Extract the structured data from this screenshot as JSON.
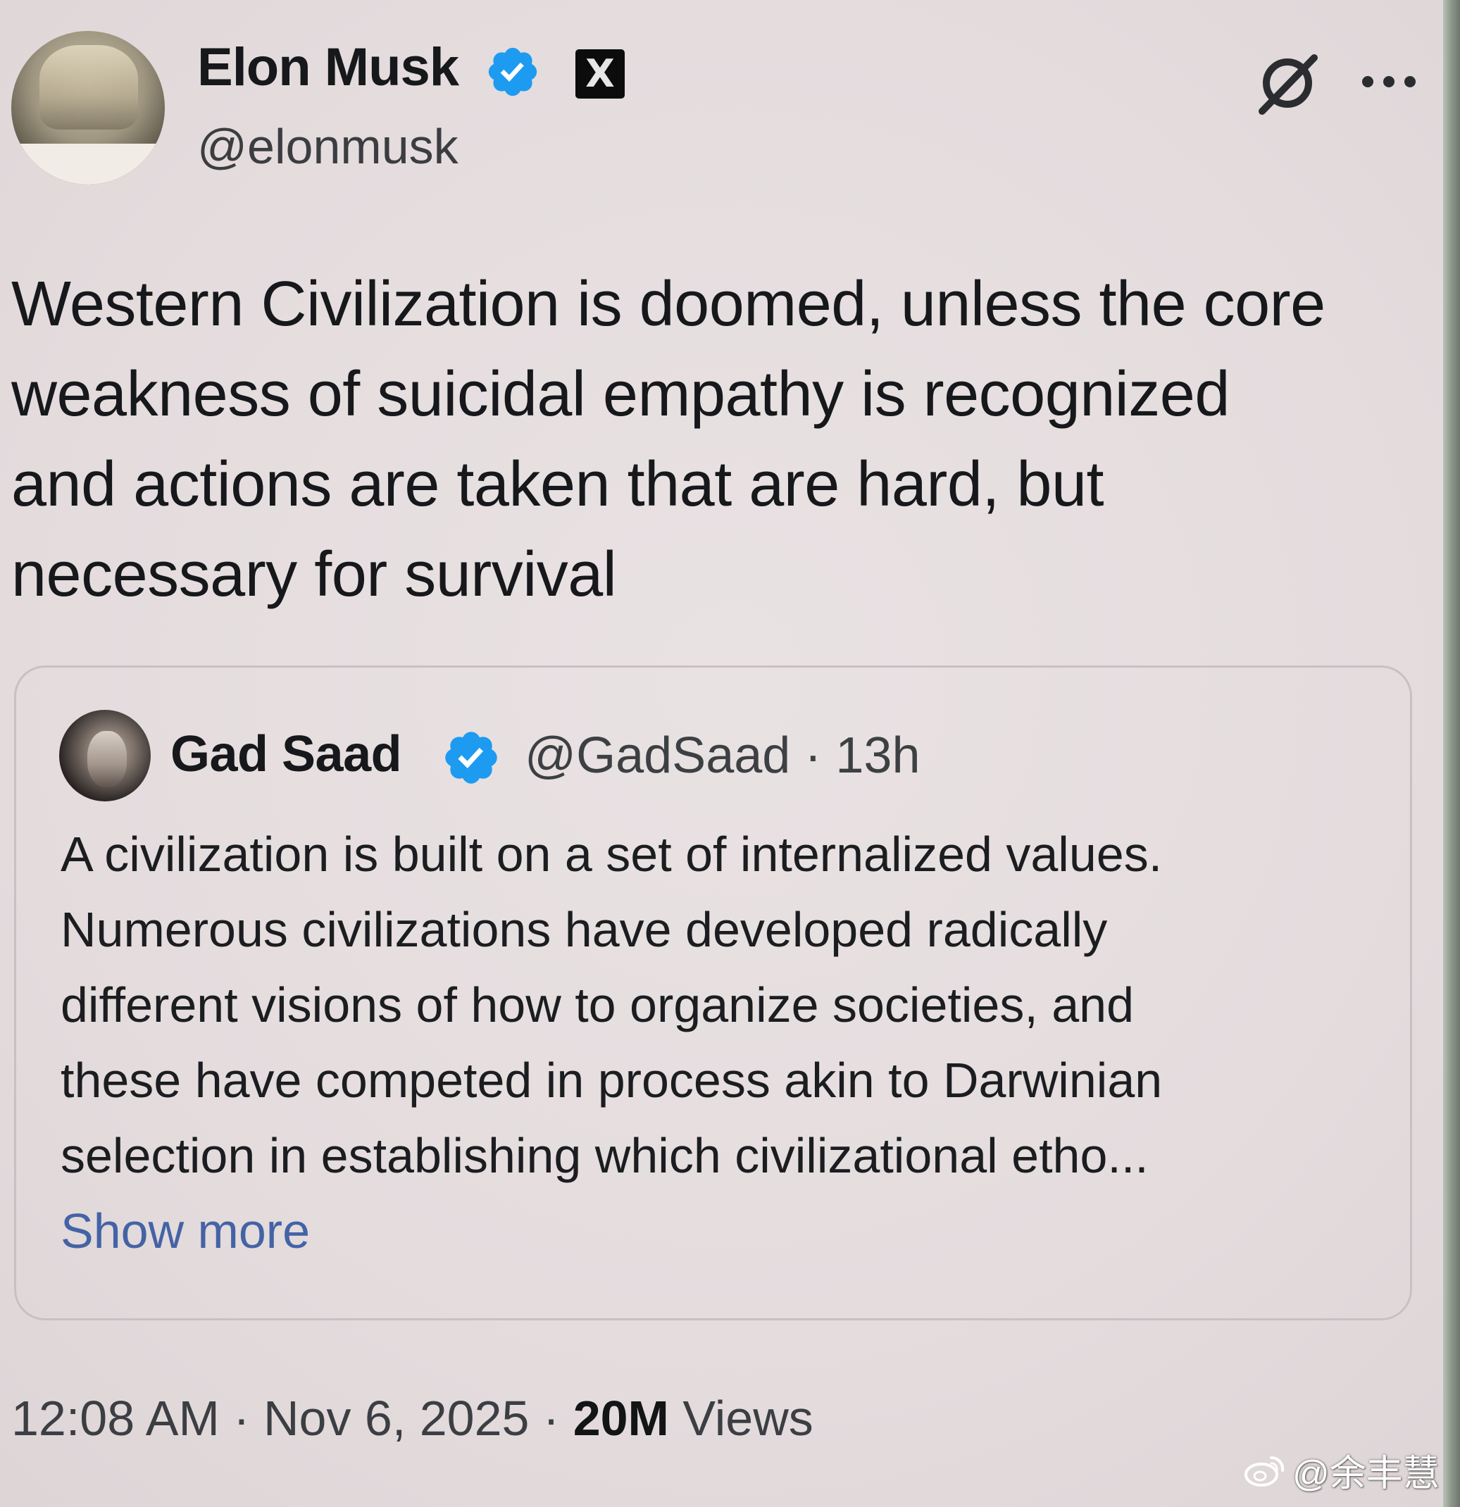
{
  "post": {
    "author": {
      "name": "Elon Musk",
      "handle": "@elonmusk",
      "verified": true,
      "affiliation_badge": "X"
    },
    "text_lines": [
      "Western Civilization is doomed, unless the core",
      "weakness of suicidal empathy is recognized",
      "and actions are taken that are hard, but",
      "necessary for survival"
    ],
    "quoted": {
      "name": "Gad Saad",
      "handle": "@GadSaad",
      "separator": "·",
      "age": "13h",
      "verified": true,
      "text_lines": [
        "A civilization is built on a set of internalized values.",
        "Numerous civilizations have developed radically",
        "different visions of how to organize societies, and",
        "these have competed in process akin to Darwinian",
        "selection in establishing which civilizational etho..."
      ],
      "show_more": "Show more"
    },
    "footer": {
      "time": "12:08 AM",
      "sep1": "·",
      "date": "Nov 6, 2025",
      "sep2": "·",
      "views_count": "20M",
      "views_label": "Views"
    }
  },
  "icons": {
    "verified": "verified-badge-icon",
    "grok": "grok-icon",
    "more": "more-options-icon",
    "weibo": "weibo-icon"
  },
  "watermark": {
    "text": "@余丰慧"
  },
  "colors": {
    "background": "#e6dfe0",
    "verified_blue": "#1d9bf0",
    "link_blue": "#4463a6",
    "text": "#16181b"
  }
}
